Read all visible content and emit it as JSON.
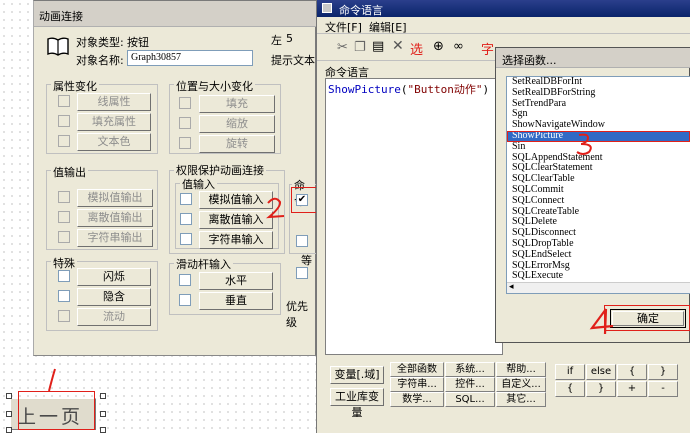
{
  "anim_dialog": {
    "title": "动画连接",
    "obj_type_label": "对象类型:",
    "obj_type_value": "按钮",
    "obj_name_label": "对象名称:",
    "obj_name_value": "Graph30857",
    "left_label": "左",
    "left_value": "5",
    "hint_label": "提示文本",
    "attr_group": "属性变化",
    "attr_buttons": [
      "线属性",
      "填充属性",
      "文本色"
    ],
    "pos_group": "位置与大小变化",
    "pos_buttons": [
      "填充",
      "缩放",
      "旋转"
    ],
    "output_group": "值输出",
    "output_buttons": [
      "模拟值输出",
      "离散值输出",
      "字符串输出"
    ],
    "priv_group": "权限保护动画连接",
    "input_group": "值输入",
    "input_buttons": [
      "模拟值输入",
      "离散值输入",
      "字符串输入"
    ],
    "cmd_group_partial": "命令",
    "special_group": "特殊",
    "special_buttons": [
      "闪烁",
      "隐含",
      "流动"
    ],
    "slider_group": "滑动杆输入",
    "slider_buttons": [
      "水平",
      "垂直"
    ],
    "priority_partial": "优先级",
    "equal_partial": "等"
  },
  "cmd_window": {
    "title": "命令语言",
    "menu": [
      "文件[F]",
      "编辑[E]"
    ],
    "toolbar_partial": "字",
    "editor_label": "命令语言",
    "code_func": "ShowPicture",
    "code_open": "(",
    "code_arg": "\"Button动作\"",
    "code_close": ")",
    "bottom_left": [
      "变量[.域]",
      "工业库变量"
    ],
    "bottom_grid": [
      [
        "全部函数",
        "系统...",
        "帮助..."
      ],
      [
        "字符串...",
        "控件...",
        "自定义..."
      ],
      [
        "数学...",
        "SQL...",
        "其它..."
      ]
    ],
    "ops_row1": [
      "if",
      "else",
      "{",
      "}"
    ],
    "ops_row2": [
      "{",
      "}",
      "+",
      "-"
    ]
  },
  "func_dialog": {
    "title": "选择函数...",
    "items": [
      "SetRealDBForInt",
      "SetRealDBForString",
      "SetTrendPara",
      "Sgn",
      "ShowNavigateWindow",
      "ShowPicture",
      "Sin",
      "SQLAppendStatement",
      "SQLClearStatement",
      "SQLClearTable",
      "SQLCommit",
      "SQLConnect",
      "SQLCreateTable",
      "SQLDelete",
      "SQLDisconnect",
      "SQLDropTable",
      "SQLEndSelect",
      "SQLErrorMsg",
      "SQLExecute"
    ],
    "selected_index": 5,
    "ok_label": "确定"
  },
  "canvas_button": {
    "label": "上一页"
  },
  "annotations": {
    "one": "1",
    "two": "2",
    "three": "3",
    "four": "4"
  },
  "colors": {
    "annotation": "#e0201a",
    "selection": "#316ac5",
    "title_active": "#0a246a"
  }
}
